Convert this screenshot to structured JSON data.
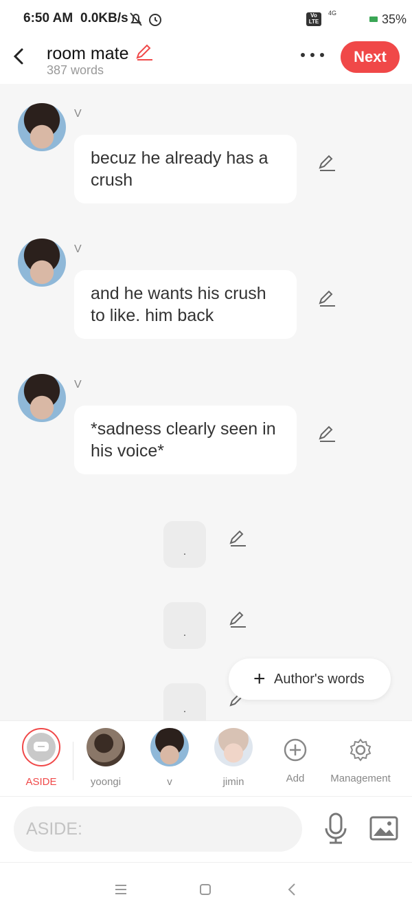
{
  "status_bar": {
    "time": "6:50 AM",
    "net_speed": "0.0KB/s",
    "signal_labels": [
      "Vo LTE",
      "4G"
    ],
    "battery": "35%",
    "icons": [
      "bell-off-icon",
      "alarm-icon",
      "volte-icon",
      "signal-icon",
      "battery-icon"
    ]
  },
  "header": {
    "title": "room mate",
    "word_count": "387 words",
    "next_label": "Next",
    "icons": [
      "back-icon",
      "edit-title-icon",
      "more-icon"
    ]
  },
  "messages": [
    {
      "sender": "V",
      "text": "becuz he already has a crush"
    },
    {
      "sender": "V",
      "text": "and he wants his crush to like. him back"
    },
    {
      "sender": "V",
      "text": "*sadness clearly seen in his voice*"
    }
  ],
  "aside_messages": [
    ".",
    ".",
    "."
  ],
  "author_words_label": "Author's words",
  "characters": [
    {
      "name": "ASIDE",
      "selected": true
    },
    {
      "name": "yoongi"
    },
    {
      "name": "v"
    },
    {
      "name": "jimin"
    },
    {
      "name": "Add"
    },
    {
      "name": "Management"
    }
  ],
  "input": {
    "placeholder": "ASIDE:"
  },
  "colors": {
    "accent": "#f04848",
    "background": "#f6f6f6",
    "bubble": "#ffffff"
  }
}
